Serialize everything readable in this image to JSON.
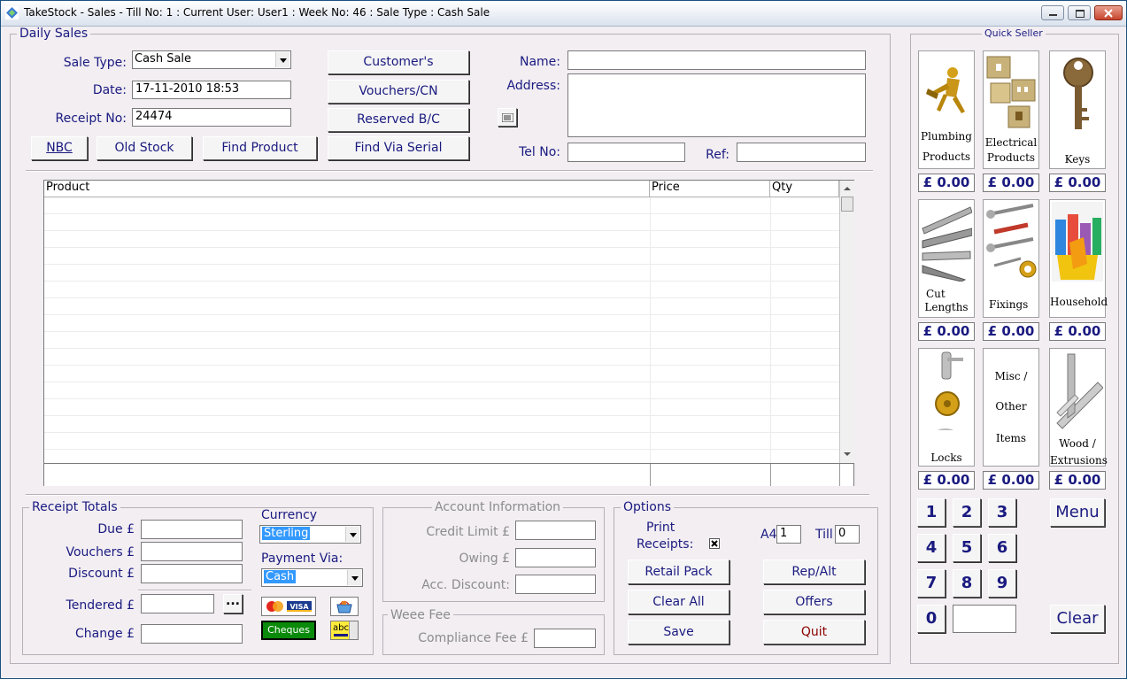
{
  "window": {
    "title": "TakeStock - Sales - Till No: 1 : Current User: User1 : Week No: 46 : Sale Type : Cash Sale"
  },
  "daily_sales": {
    "legend": "Daily Sales",
    "sale_type_label": "Sale Type:",
    "sale_type_value": "Cash Sale",
    "date_label": "Date:",
    "date_value": "17-11-2010 18:53",
    "receipt_label": "Receipt No:",
    "receipt_value": "24474",
    "buttons": {
      "nbc": "NBC",
      "old_stock": "Old Stock",
      "find_product": "Find Product",
      "customers": "Customer's",
      "vouchers": "Vouchers/CN",
      "reserved": "Reserved B/C",
      "find_serial": "Find Via Serial"
    },
    "name_label": "Name:",
    "address_label": "Address:",
    "tel_label": "Tel No:",
    "ref_label": "Ref:"
  },
  "grid": {
    "columns": [
      "Product",
      "Price",
      "Qty"
    ]
  },
  "receipt_totals": {
    "legend": "Receipt Totals",
    "due_label": "Due £",
    "vouchers_label": "Vouchers £",
    "discount_label": "Discount £",
    "tendered_label": "Tendered £",
    "change_label": "Change £",
    "browse_label": "...",
    "currency_label": "Currency",
    "currency_value": "Sterling",
    "payment_label": "Payment Via:",
    "payment_value": "Cash",
    "cheques_label": "Cheques",
    "abc_label": "abc"
  },
  "account_info": {
    "legend": "Account Information",
    "credit_label": "Credit Limit £",
    "owing_label": "Owing £",
    "acc_discount_label": "Acc. Discount:"
  },
  "weee": {
    "legend": "Weee Fee",
    "compliance_label": "Compliance Fee £"
  },
  "options": {
    "legend": "Options",
    "print_label_1": "Print",
    "print_label_2": "Receipts:",
    "a4_label": "A4",
    "a4_value": "1",
    "till_label": "Till",
    "till_value": "0",
    "buttons": {
      "retail_pack": "Retail Pack",
      "rep_alt": "Rep/Alt",
      "clear_all": "Clear All",
      "offers": "Offers",
      "save": "Save",
      "quit": "Quit"
    }
  },
  "quick_seller": {
    "legend": "Quick Seller",
    "tiles": [
      {
        "l1": "Plumbing",
        "l2": "Products",
        "price": "£ 0.00"
      },
      {
        "l1": "Electrical",
        "l2": "Products",
        "price": "£ 0.00"
      },
      {
        "l1": "Keys",
        "l2": "",
        "price": "£ 0.00"
      },
      {
        "l1": "Cut",
        "l2": "Lengths",
        "price": "£ 0.00"
      },
      {
        "l1": "Fixings",
        "l2": "",
        "price": "£ 0.00"
      },
      {
        "l1": "Household",
        "l2": "",
        "price": "£ 0.00"
      },
      {
        "l1": "Locks",
        "l2": "",
        "price": "£ 0.00"
      },
      {
        "l1": "Misc /",
        "l2": "Other",
        "l3": "Items",
        "price": "£ 0.00"
      },
      {
        "l1": "Wood /",
        "l2": "Extrusions",
        "price": "£ 0.00"
      }
    ],
    "keypad": [
      "1",
      "2",
      "3",
      "4",
      "5",
      "6",
      "7",
      "8",
      "9",
      "0"
    ],
    "menu_label": "Menu",
    "clear_label": "Clear"
  },
  "colors": {
    "label": "#1a1a80",
    "window_bg": "#f2eef2",
    "selection": "#3399ff",
    "cheques_bg": "#008000"
  }
}
